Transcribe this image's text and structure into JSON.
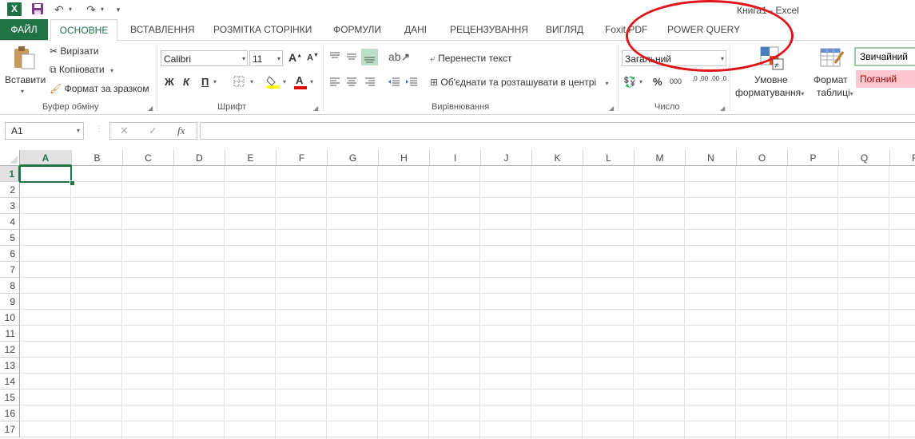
{
  "window": {
    "title": "Книга1 - Excel"
  },
  "qat": {
    "app_icon": "X",
    "save_icon": "floppy-disk-icon",
    "undo_icon": "undo-icon",
    "redo_icon": "redo-icon"
  },
  "tabs": [
    {
      "label": "ФАЙЛ"
    },
    {
      "label": "ОСНОВНЕ"
    },
    {
      "label": "ВСТАВЛЕННЯ"
    },
    {
      "label": "РОЗМІТКА СТОРІНКИ"
    },
    {
      "label": "ФОРМУЛИ"
    },
    {
      "label": "ДАНІ"
    },
    {
      "label": "РЕЦЕНЗУВАННЯ"
    },
    {
      "label": "ВИГЛЯД"
    },
    {
      "label": "Foxit PDF"
    },
    {
      "label": "POWER QUERY"
    }
  ],
  "ribbon": {
    "clipboard": {
      "paste": "Вставити",
      "cut": "Вирізати",
      "copy": "Копіювати",
      "format_painter": "Формат за зразком",
      "group": "Буфер обміну"
    },
    "font": {
      "family": "Calibri",
      "size": "11",
      "grow": "A",
      "shrink": "A",
      "bold": "Ж",
      "italic": "К",
      "underline": "П",
      "color_letter": "A",
      "group": "Шрифт",
      "font_color": "#e00000",
      "fill_color": "#ffff00"
    },
    "alignment": {
      "wrap": "Перенести текст",
      "merge": "Об'єднати та розташувати в центрі",
      "group": "Вирівнювання"
    },
    "number": {
      "format": "Загальний",
      "percent": "%",
      "thousands": "000",
      "inc_decimal": ",0 ,00",
      "dec_decimal": ",00 ,0",
      "group": "Число"
    },
    "styles": {
      "conditional_line1": "Умовне",
      "conditional_line2": "форматування",
      "table_line1": "Формат",
      "table_line2": "таблиці",
      "normal": "Звичайний",
      "bad": "Поганий"
    }
  },
  "formula_bar": {
    "name_box": "A1",
    "cancel": "✕",
    "enter": "✓",
    "fx": "fx",
    "value": ""
  },
  "grid": {
    "columns": [
      "A",
      "B",
      "C",
      "D",
      "E",
      "F",
      "G",
      "H",
      "I",
      "J",
      "K",
      "L",
      "M",
      "N",
      "O",
      "P",
      "Q",
      "R"
    ],
    "rows": [
      "1",
      "2",
      "3",
      "4",
      "5",
      "6",
      "7",
      "8",
      "9",
      "10",
      "11",
      "12",
      "13",
      "14",
      "15",
      "16",
      "17"
    ],
    "active_cell": "A1"
  },
  "colors": {
    "accent": "#217346",
    "annotation": "#e0141c"
  }
}
